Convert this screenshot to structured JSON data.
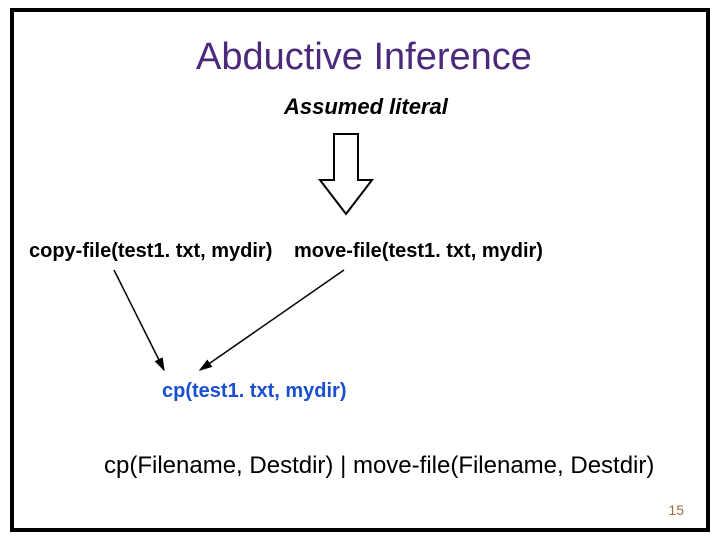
{
  "title": "Abductive Inference",
  "subtitle": "Assumed literal",
  "literals": {
    "copy": "copy-file(test1. txt, mydir)",
    "move": "move-file(test1. txt, mydir)",
    "cp": "cp(test1. txt, mydir)"
  },
  "rule": "cp(Filename, Destdir) | move-file(Filename, Destdir)",
  "page_number": "15"
}
